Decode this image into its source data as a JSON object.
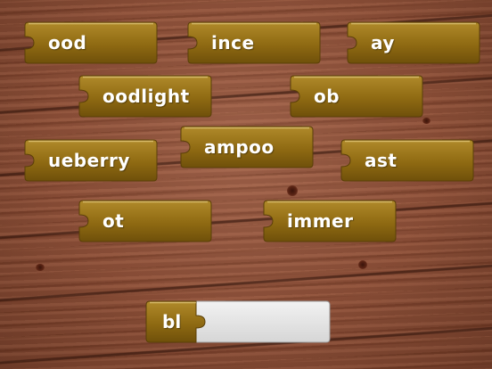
{
  "pieces": [
    {
      "label": "ood"
    },
    {
      "label": "ince"
    },
    {
      "label": "ay"
    },
    {
      "label": "oodlight"
    },
    {
      "label": "ob"
    },
    {
      "label": "ampoo"
    },
    {
      "label": "ueberry"
    },
    {
      "label": "ast"
    },
    {
      "label": "ot"
    },
    {
      "label": "immer"
    }
  ],
  "answer": {
    "prefix": "bl",
    "slot_value": ""
  },
  "colors": {
    "piece": "#8f6a12",
    "piece_light": "#b08a2a",
    "wood": "#8a4a32",
    "slot": "#e2e2e2"
  }
}
